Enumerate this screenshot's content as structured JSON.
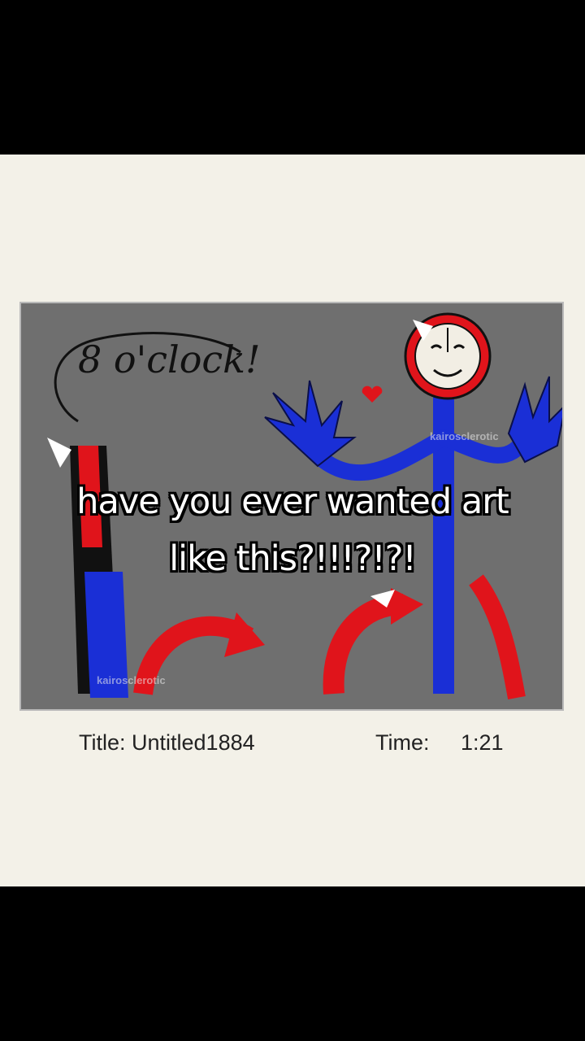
{
  "caption": {
    "line1": "have you ever wanted art",
    "line2": "like this?!!!?!?!"
  },
  "artwork": {
    "scribble_text": "8 o'clock!",
    "watermark_1": "kairosclerotic",
    "watermark_2": "kairosclerotic",
    "colors": {
      "background": "#6f6f6f",
      "blue": "#1a2fd6",
      "red": "#e0141b",
      "clock_face": "#f2eee4"
    }
  },
  "info": {
    "title_text": "Title: Untitled1884",
    "time_label": "Time:",
    "time_value": "1:21"
  }
}
